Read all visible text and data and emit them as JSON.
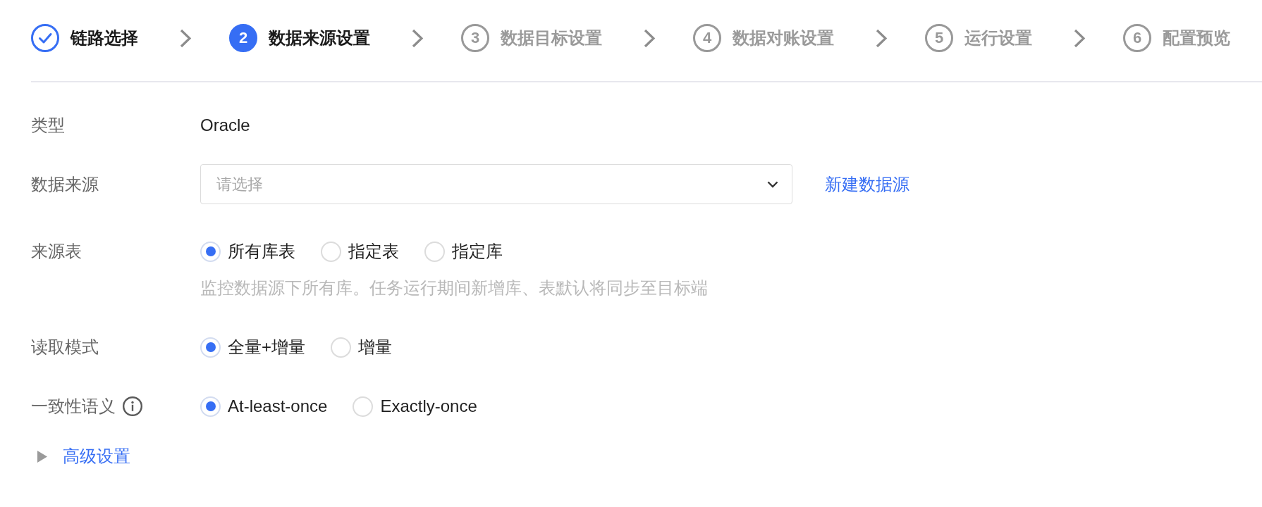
{
  "steps": [
    {
      "label": "链路选择",
      "kind": "done"
    },
    {
      "number": "2",
      "label": "数据来源设置",
      "kind": "current"
    },
    {
      "number": "3",
      "label": "数据目标设置",
      "kind": "pending"
    },
    {
      "number": "4",
      "label": "数据对账设置",
      "kind": "pending"
    },
    {
      "number": "5",
      "label": "运行设置",
      "kind": "pending"
    },
    {
      "number": "6",
      "label": "配置预览",
      "kind": "pending"
    }
  ],
  "form": {
    "rows": [
      {
        "kind": "text",
        "label": "类型",
        "value": "Oracle"
      },
      {
        "kind": "select",
        "label": "数据来源",
        "placeholder": "请选择",
        "link": "新建数据源"
      },
      {
        "kind": "radio",
        "label": "来源表",
        "options": [
          {
            "label": "所有库表",
            "selected": true
          },
          {
            "label": "指定表",
            "selected": false
          },
          {
            "label": "指定库",
            "selected": false
          }
        ],
        "help": "监控数据源下所有库。任务运行期间新增库、表默认将同步至目标端"
      },
      {
        "kind": "radio",
        "label": "读取模式",
        "options": [
          {
            "label": "全量+增量",
            "selected": true
          },
          {
            "label": "增量",
            "selected": false
          }
        ]
      },
      {
        "kind": "radio",
        "label": "一致性语义",
        "info": true,
        "options": [
          {
            "label": "At-least-once",
            "selected": true
          },
          {
            "label": "Exactly-once",
            "selected": false
          }
        ]
      }
    ]
  },
  "advanced": {
    "label": "高级设置",
    "expanded": false
  }
}
